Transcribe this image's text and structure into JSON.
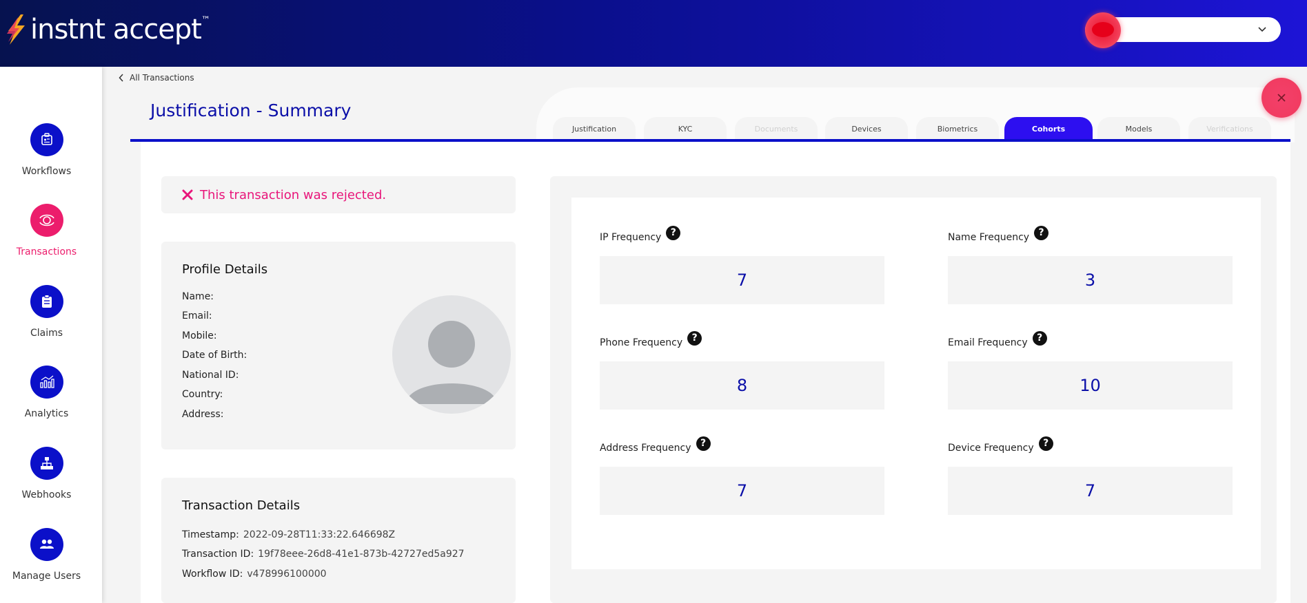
{
  "brand": {
    "name": "instnt accept",
    "tm": "™"
  },
  "sidebar": {
    "items": [
      {
        "label": "Workflows",
        "icon": "workflows-icon",
        "active": false
      },
      {
        "label": "Transactions",
        "icon": "transactions-icon",
        "active": true
      },
      {
        "label": "Claims",
        "icon": "claims-icon",
        "active": false
      },
      {
        "label": "Analytics",
        "icon": "analytics-icon",
        "active": false
      },
      {
        "label": "Webhooks",
        "icon": "webhooks-icon",
        "active": false
      },
      {
        "label": "Manage Users",
        "icon": "users-icon",
        "active": false
      }
    ]
  },
  "breadcrumb": {
    "back_label": "All Transactions"
  },
  "page": {
    "title": "Justification - Summary"
  },
  "tabs": [
    {
      "label": "Justification",
      "state": "normal"
    },
    {
      "label": "KYC",
      "state": "normal"
    },
    {
      "label": "Documents",
      "state": "disabled"
    },
    {
      "label": "Devices",
      "state": "normal"
    },
    {
      "label": "Biometrics",
      "state": "normal"
    },
    {
      "label": "Cohorts",
      "state": "active"
    },
    {
      "label": "Models",
      "state": "normal"
    },
    {
      "label": "Verifications",
      "state": "disabled"
    }
  ],
  "status": {
    "message": "This transaction was rejected."
  },
  "profile": {
    "title": "Profile Details",
    "fields": [
      "Name:",
      "Email:",
      "Mobile:",
      "Date of Birth:",
      "National ID:",
      "Country:",
      "Address:"
    ]
  },
  "transaction": {
    "title": "Transaction Details",
    "timestamp_label": "Timestamp:",
    "timestamp": "2022-09-28T11:33:22.646698Z",
    "id_label": "Transaction ID:",
    "id": "19f78eee-26d8-41e1-873b-42727ed5a927",
    "workflow_label": "Workflow ID:",
    "workflow": "v478996100000"
  },
  "frequencies": [
    {
      "label": "IP Frequency",
      "value": "7"
    },
    {
      "label": "Name Frequency",
      "value": "3"
    },
    {
      "label": "Phone Frequency",
      "value": "8"
    },
    {
      "label": "Email Frequency",
      "value": "10"
    },
    {
      "label": "Address Frequency",
      "value": "7"
    },
    {
      "label": "Device Frequency",
      "value": "7"
    }
  ],
  "colors": {
    "primary": "#0b10c9",
    "accent": "#ec1d6c",
    "reject": "#e8157a",
    "active_tab": "#2d0ff0"
  }
}
